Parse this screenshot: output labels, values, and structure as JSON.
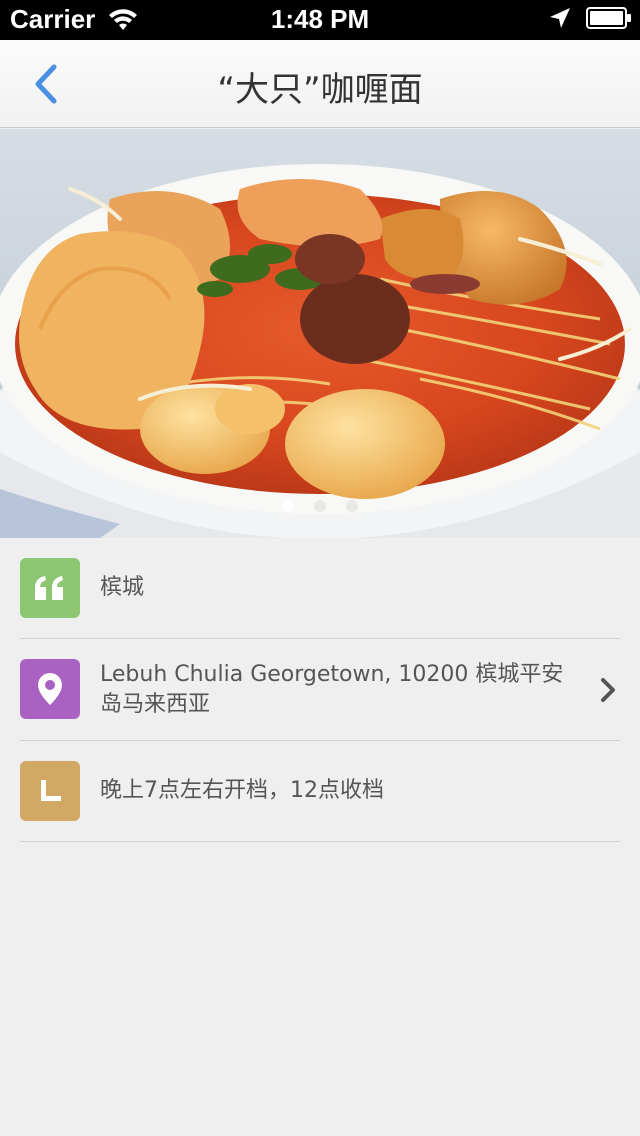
{
  "status_bar": {
    "carrier": "Carrier",
    "time": "1:48 PM"
  },
  "nav": {
    "title": "“大只”咖喱面",
    "back_icon": "chevron-left-icon"
  },
  "carousel": {
    "page_count": 3,
    "current_page": 1
  },
  "info": {
    "region": {
      "icon": "quote-icon",
      "color": "#8cc673",
      "text": "槟城"
    },
    "address": {
      "icon": "map-pin-icon",
      "color": "#a962c2",
      "text": "Lebuh Chulia Georgetown, 10200 槟城平安岛马来西亚",
      "chevron_icon": "chevron-right-icon"
    },
    "hours": {
      "icon": "clock-icon",
      "color": "#d2a865",
      "text": "晚上7点左右开档，12点收档"
    }
  },
  "colors": {
    "accent": "#4a90e2",
    "background": "#efeff0"
  }
}
